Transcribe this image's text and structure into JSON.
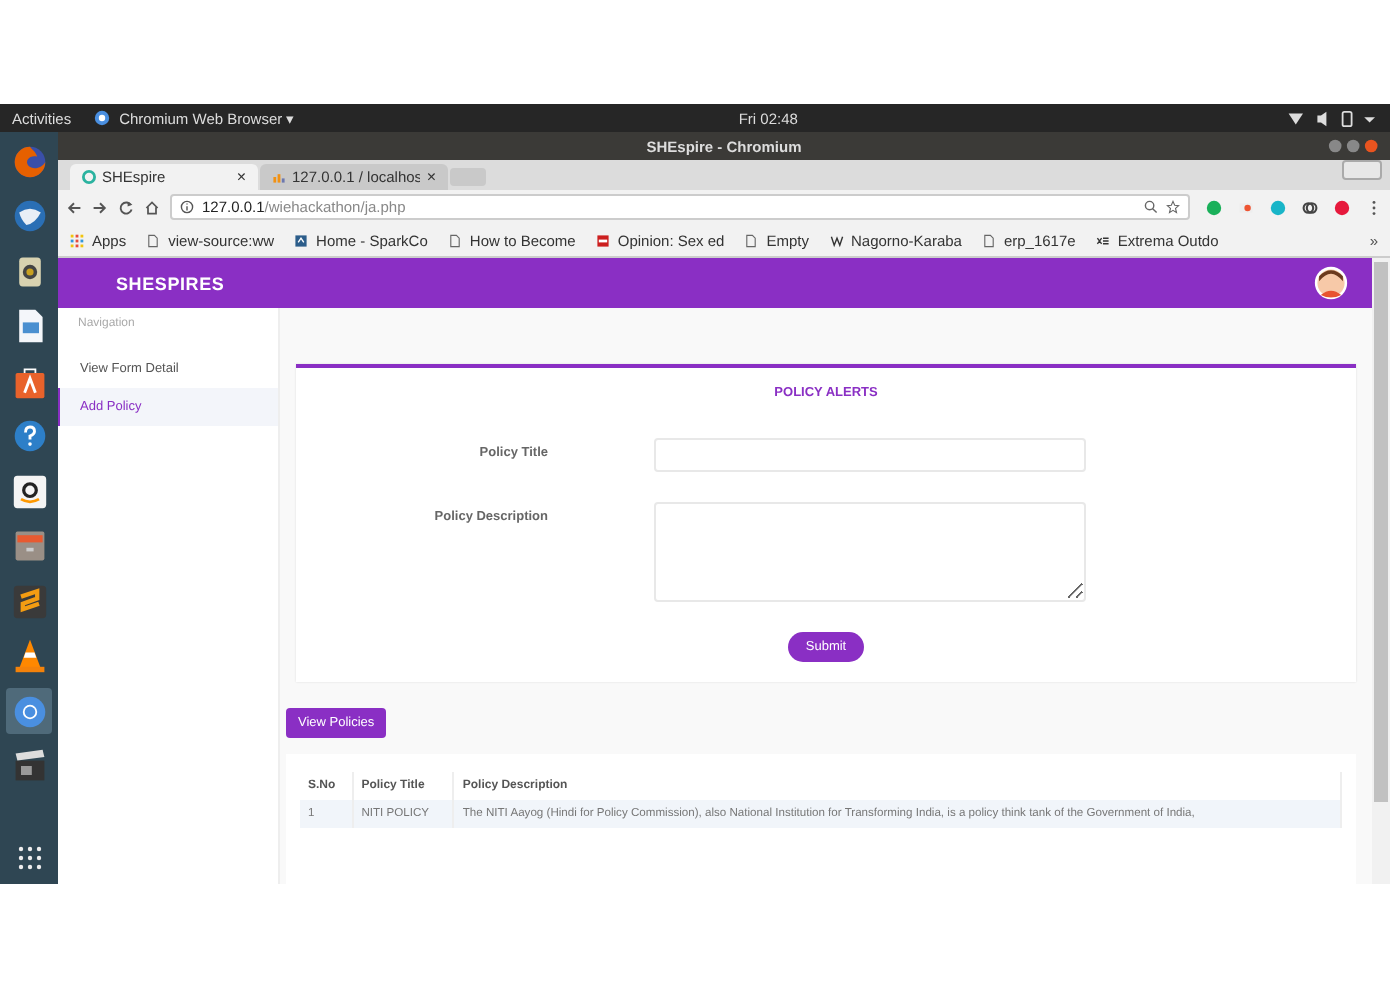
{
  "top_bar": {
    "activities": "Activities",
    "app_menu": "Chromium Web Browser ▾",
    "clock": "Fri 02:48"
  },
  "dock": [
    {
      "kind": "firefox",
      "selected": false
    },
    {
      "kind": "mail",
      "selected": false
    },
    {
      "kind": "speaker",
      "selected": false
    },
    {
      "kind": "writer",
      "selected": false
    },
    {
      "kind": "store",
      "selected": false
    },
    {
      "kind": "help",
      "selected": false
    },
    {
      "kind": "amazon",
      "selected": false
    },
    {
      "kind": "files",
      "selected": false
    },
    {
      "kind": "editor",
      "selected": false
    },
    {
      "kind": "cone",
      "selected": false
    },
    {
      "kind": "chromium",
      "selected": true
    },
    {
      "kind": "video",
      "selected": false
    }
  ],
  "window": {
    "title": "SHEspire - Chromium"
  },
  "tabs": [
    {
      "title": "SHEspire",
      "close": "×",
      "kind": "site",
      "selected": true
    },
    {
      "title": "127.0.0.1 / localhos",
      "close": "×",
      "kind": "db",
      "selected": false
    }
  ],
  "address_bar": {
    "host": "127.0.0.1",
    "path": "/wiehackathon/ja.php"
  },
  "bookmarks": [
    {
      "label": "Apps",
      "kind": "apps"
    },
    {
      "label": "view-source:ww",
      "kind": "page"
    },
    {
      "label": "Home - SparkCo",
      "kind": "site"
    },
    {
      "label": "How to Become",
      "kind": "page"
    },
    {
      "label": "Opinion: Sex ed",
      "kind": "news"
    },
    {
      "label": "Empty",
      "kind": "page"
    },
    {
      "label": "Nagorno-Karaba",
      "kind": "wiki"
    },
    {
      "label": "erp_1617e",
      "kind": "page"
    },
    {
      "label": "Extrema Outdo",
      "kind": "ext"
    }
  ],
  "bookmarks_more": "»",
  "site": {
    "brand": "SHESPIRES"
  },
  "sidebar": {
    "heading": "Navigation",
    "items": [
      {
        "label": "View Form Detail",
        "selected": false
      },
      {
        "label": "Add Policy",
        "selected": true
      }
    ]
  },
  "form": {
    "title": "POLICY ALERTS",
    "fields": [
      {
        "label": "Policy Title",
        "kind": "text"
      },
      {
        "label": "Policy Description",
        "kind": "textarea"
      }
    ],
    "submit": "Submit"
  },
  "view_button": "View Policies",
  "table": {
    "columns": [
      "S.No",
      "Policy Title",
      "Policy Description"
    ],
    "rows": [
      [
        "1",
        "NITI POLICY",
        "The NITI Aayog (Hindi for Policy Commission), also National Institution for Transforming India, is a policy think tank of the Government of India,"
      ]
    ]
  }
}
